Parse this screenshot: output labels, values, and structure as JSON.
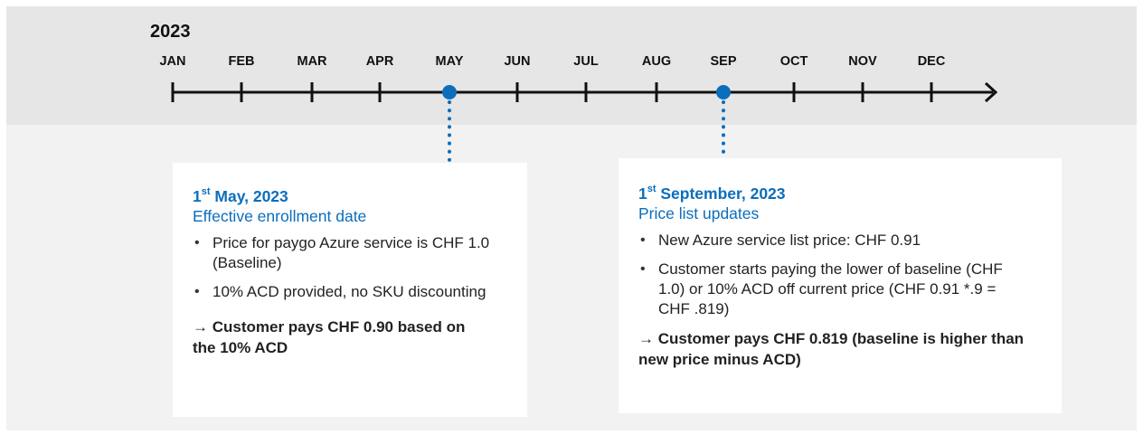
{
  "timeline": {
    "year": "2023",
    "months": [
      "JAN",
      "FEB",
      "MAR",
      "APR",
      "MAY",
      "JUN",
      "JUL",
      "AUG",
      "SEP",
      "OCT",
      "NOV",
      "DEC"
    ],
    "highlighted_months": [
      "MAY",
      "SEP"
    ],
    "marker_color": "#0a6ebd"
  },
  "cards": [
    {
      "title_day": "1",
      "title_suffix": "st",
      "title_rest": " May, 2023",
      "subtitle": "Effective enrollment date",
      "bullets": [
        "Price for paygo Azure service is CHF 1.0 (Baseline)",
        "10% ACD provided, no SKU discounting"
      ],
      "conclusion": "→ Customer pays CHF 0.90 based on the 10% ACD"
    },
    {
      "title_day": "1",
      "title_suffix": "st",
      "title_rest": " September, 2023",
      "subtitle": "Price list updates",
      "bullets": [
        "New Azure service list price: CHF 0.91",
        "Customer starts paying the lower of baseline (CHF 1.0) or 10% ACD off current price (CHF 0.91 *.9 =  CHF .819)"
      ],
      "conclusion": "→ Customer pays CHF 0.819 (baseline is higher than new price minus ACD)"
    }
  ],
  "colors": {
    "accent": "#0a6ebd",
    "top_band": "#e6e6e6",
    "bottom_band": "#f2f2f2"
  }
}
